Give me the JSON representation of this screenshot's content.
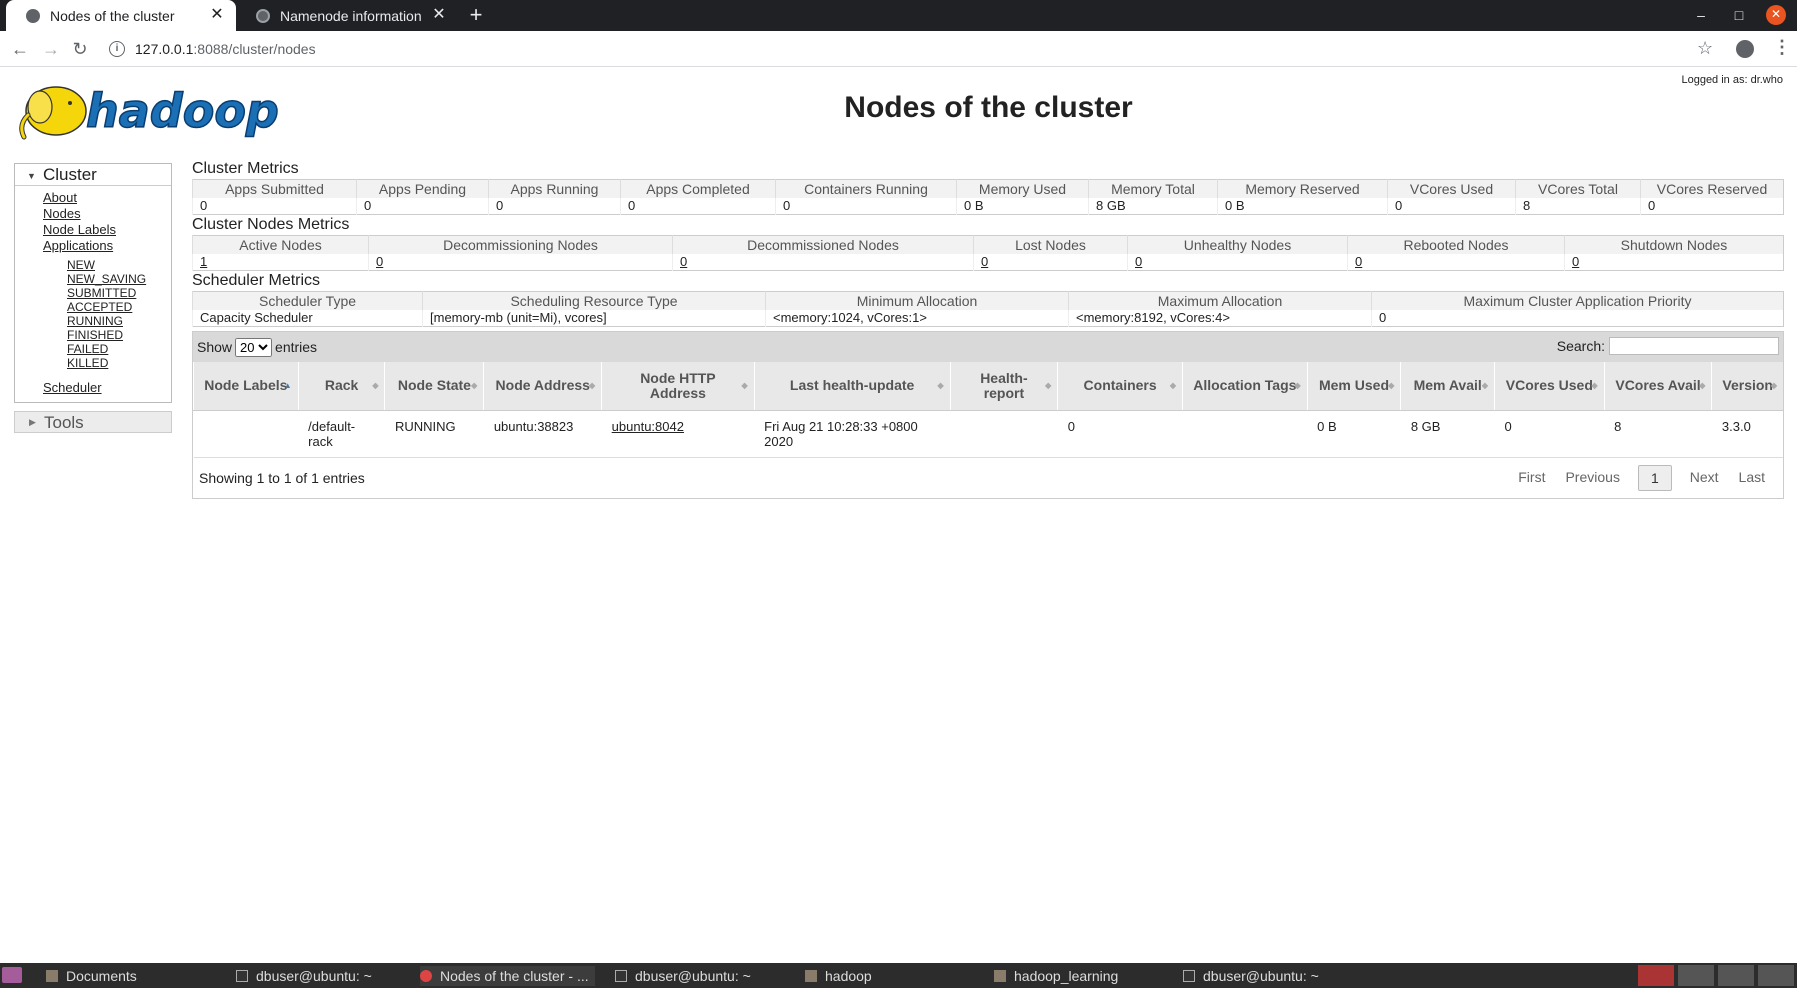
{
  "browser": {
    "tabs": [
      {
        "title": "Nodes of the cluster",
        "active": true
      },
      {
        "title": "Namenode information",
        "active": false
      }
    ],
    "url_host": "127.0.0.1",
    "url_path": ":8088/cluster/nodes"
  },
  "header": {
    "logged_in": "Logged in as: dr.who",
    "title": "Nodes of the cluster"
  },
  "nav": {
    "cluster_label": "Cluster",
    "links": [
      "About",
      "Nodes",
      "Node Labels",
      "Applications"
    ],
    "app_states": [
      "NEW",
      "NEW_SAVING",
      "SUBMITTED",
      "ACCEPTED",
      "RUNNING",
      "FINISHED",
      "FAILED",
      "KILLED"
    ],
    "scheduler": "Scheduler",
    "tools_label": "Tools"
  },
  "cluster_metrics": {
    "title": "Cluster Metrics",
    "headers": [
      "Apps Submitted",
      "Apps Pending",
      "Apps Running",
      "Apps Completed",
      "Containers Running",
      "Memory Used",
      "Memory Total",
      "Memory Reserved",
      "VCores Used",
      "VCores Total",
      "VCores Reserved"
    ],
    "values": [
      "0",
      "0",
      "0",
      "0",
      "0",
      "0 B",
      "8 GB",
      "0 B",
      "0",
      "8",
      "0"
    ]
  },
  "cluster_nodes_metrics": {
    "title": "Cluster Nodes Metrics",
    "headers": [
      "Active Nodes",
      "Decommissioning Nodes",
      "Decommissioned Nodes",
      "Lost Nodes",
      "Unhealthy Nodes",
      "Rebooted Nodes",
      "Shutdown Nodes"
    ],
    "values": [
      "1",
      "0",
      "0",
      "0",
      "0",
      "0",
      "0"
    ]
  },
  "scheduler_metrics": {
    "title": "Scheduler Metrics",
    "headers": [
      "Scheduler Type",
      "Scheduling Resource Type",
      "Minimum Allocation",
      "Maximum Allocation",
      "Maximum Cluster Application Priority"
    ],
    "values": [
      "Capacity Scheduler",
      "[memory-mb (unit=Mi), vcores]",
      "<memory:1024, vCores:1>",
      "<memory:8192, vCores:4>",
      "0"
    ]
  },
  "nodes_table": {
    "show_label": "Show",
    "entries_label": "entries",
    "page_size": "20",
    "search_label": "Search:",
    "headers": [
      "Node Labels",
      "Rack",
      "Node State",
      "Node Address",
      "Node HTTP Address",
      "Last health-update",
      "Health-report",
      "Containers",
      "Allocation Tags",
      "Mem Used",
      "Mem Avail",
      "VCores Used",
      "VCores Avail",
      "Version"
    ],
    "rows": [
      [
        "",
        "/default-rack",
        "RUNNING",
        "ubuntu:38823",
        "ubuntu:8042",
        "Fri Aug 21 10:28:33 +0800 2020",
        "",
        "0",
        "",
        "0 B",
        "8 GB",
        "0",
        "8",
        "3.3.0"
      ]
    ],
    "info": "Showing 1 to 1 of 1 entries",
    "pager": {
      "first": "First",
      "previous": "Previous",
      "current": "1",
      "next": "Next",
      "last": "Last"
    }
  },
  "taskbar": {
    "items": [
      "Documents",
      "dbuser@ubuntu: ~",
      "Nodes of the cluster - ...",
      "dbuser@ubuntu: ~",
      "hadoop",
      "hadoop_learning",
      "dbuser@ubuntu: ~"
    ]
  },
  "colors": {
    "accent": "#e95420",
    "chrome_dark": "#202124",
    "logo_yellow": "#f5d60a",
    "logo_blue": "#1a6fb5"
  }
}
